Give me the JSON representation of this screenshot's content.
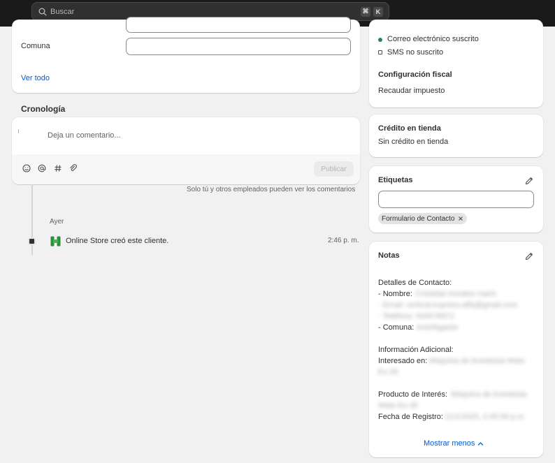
{
  "search": {
    "placeholder": "Buscar",
    "shortcut_keys": [
      "⌘",
      "K"
    ]
  },
  "address_card": {
    "comuna_label": "Comuna",
    "comuna_value": "",
    "see_all": "Ver todo"
  },
  "timeline": {
    "title": "Cronología",
    "comment_placeholder": "Deja un comentario...",
    "publish_button": "Publicar",
    "visibility_note": "Solo tú y otros empleados pueden ver los comentarios",
    "date_header": "Ayer",
    "event_text": "Online Store creó este cliente.",
    "event_time": "2:46 p. m."
  },
  "marketing": {
    "email_status": "Correo electrónico suscrito",
    "sms_status": "SMS no suscrito",
    "email_dot_color": "#29845a"
  },
  "tax": {
    "title": "Configuración fiscal",
    "value": "Recaudar impuesto"
  },
  "store_credit": {
    "title": "Crédito en tienda",
    "value": "Sin crédito en tienda"
  },
  "tags": {
    "title": "Etiquetas",
    "input_value": "",
    "items": [
      "Formulario de Contacto"
    ]
  },
  "notes": {
    "title": "Notas",
    "contact_header": "Detalles de Contacto:",
    "name_label": "- Nombre:",
    "name_value": "Cristobal morales marin",
    "email_line": "- Email: certical.express.affa@gmail.com",
    "phone_line": "- Teléfono: 934578972",
    "comuna_label": "- Comuna:",
    "comuna_value": "Antofagasta",
    "additional_header": "Información Adicional:",
    "interest_label": "Interesado en:",
    "interest_value_1": "Máquina de Anestesia Wato",
    "interest_value_2": "Ex-35",
    "product_label": "Producto de Interés:",
    "product_value_1": "Máquina de Anestesia",
    "product_value_2": "Wato Ex-35",
    "date_label": "Fecha de Registro:",
    "date_value": "21/1/2025, 2:45:59 p.m.",
    "show_less": "Mostrar menos"
  }
}
